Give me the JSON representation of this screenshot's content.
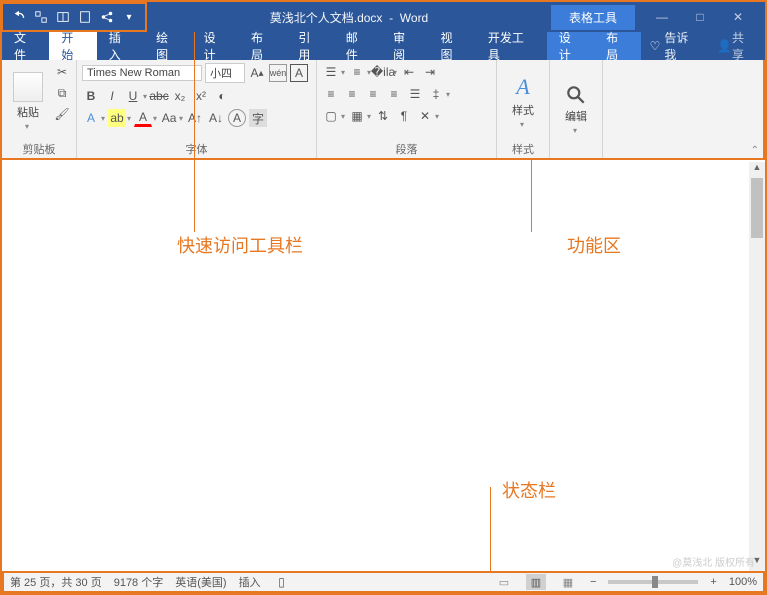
{
  "title": {
    "doc": "莫浅北个人文档.docx",
    "app": "Word",
    "context_tab": "表格工具"
  },
  "qat_icons": [
    "undo",
    "touch-mode",
    "read-aloud",
    "page-width",
    "share-doc",
    "customize"
  ],
  "tabs": [
    "文件",
    "开始",
    "插入",
    "绘图",
    "设计",
    "布局",
    "引用",
    "邮件",
    "审阅",
    "视图",
    "开发工具"
  ],
  "context_tabs": [
    "设计",
    "布局"
  ],
  "active_tab": "开始",
  "tellme": "告诉我",
  "share": "共享",
  "ribbon": {
    "clipboard": {
      "label": "剪贴板",
      "paste": "粘贴"
    },
    "font": {
      "label": "字体",
      "name": "Times New Roman",
      "size": "小四"
    },
    "paragraph": {
      "label": "段落"
    },
    "styles": {
      "label": "样式",
      "btn": "样式"
    },
    "editing": {
      "label": "",
      "btn": "编辑"
    }
  },
  "status": {
    "page": "第 25 页，共 30 页",
    "words": "9178 个字",
    "lang": "英语(美国)",
    "mode": "插入",
    "zoom": "100%"
  },
  "annotations": {
    "qat": "快速访问工具栏",
    "ribbon": "功能区",
    "status": "状态栏"
  },
  "watermark": "@莫浅北 版权所有"
}
